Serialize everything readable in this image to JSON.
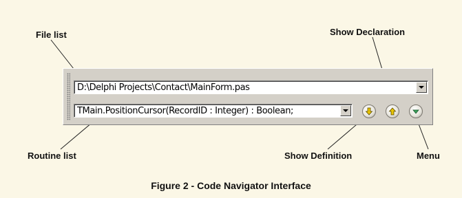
{
  "callouts": {
    "file_list": "File list",
    "show_declaration": "Show Declaration",
    "routine_list": "Routine list",
    "show_definition": "Show Definition",
    "menu": "Menu"
  },
  "toolbar": {
    "file_combo_value": "D:\\Delphi Projects\\Contact\\MainForm.pas",
    "routine_combo_value": "TMain.PositionCursor(RecordID : Integer) : Boolean;",
    "buttons": [
      {
        "name": "show-definition",
        "icon": "down-arrow-icon",
        "color": "#e8c400"
      },
      {
        "name": "show-declaration",
        "icon": "up-arrow-icon",
        "color": "#e8c400"
      },
      {
        "name": "menu",
        "icon": "chevron-down-icon",
        "color": "#3aa05a"
      }
    ]
  },
  "caption": "Figure 2 - Code Navigator Interface"
}
